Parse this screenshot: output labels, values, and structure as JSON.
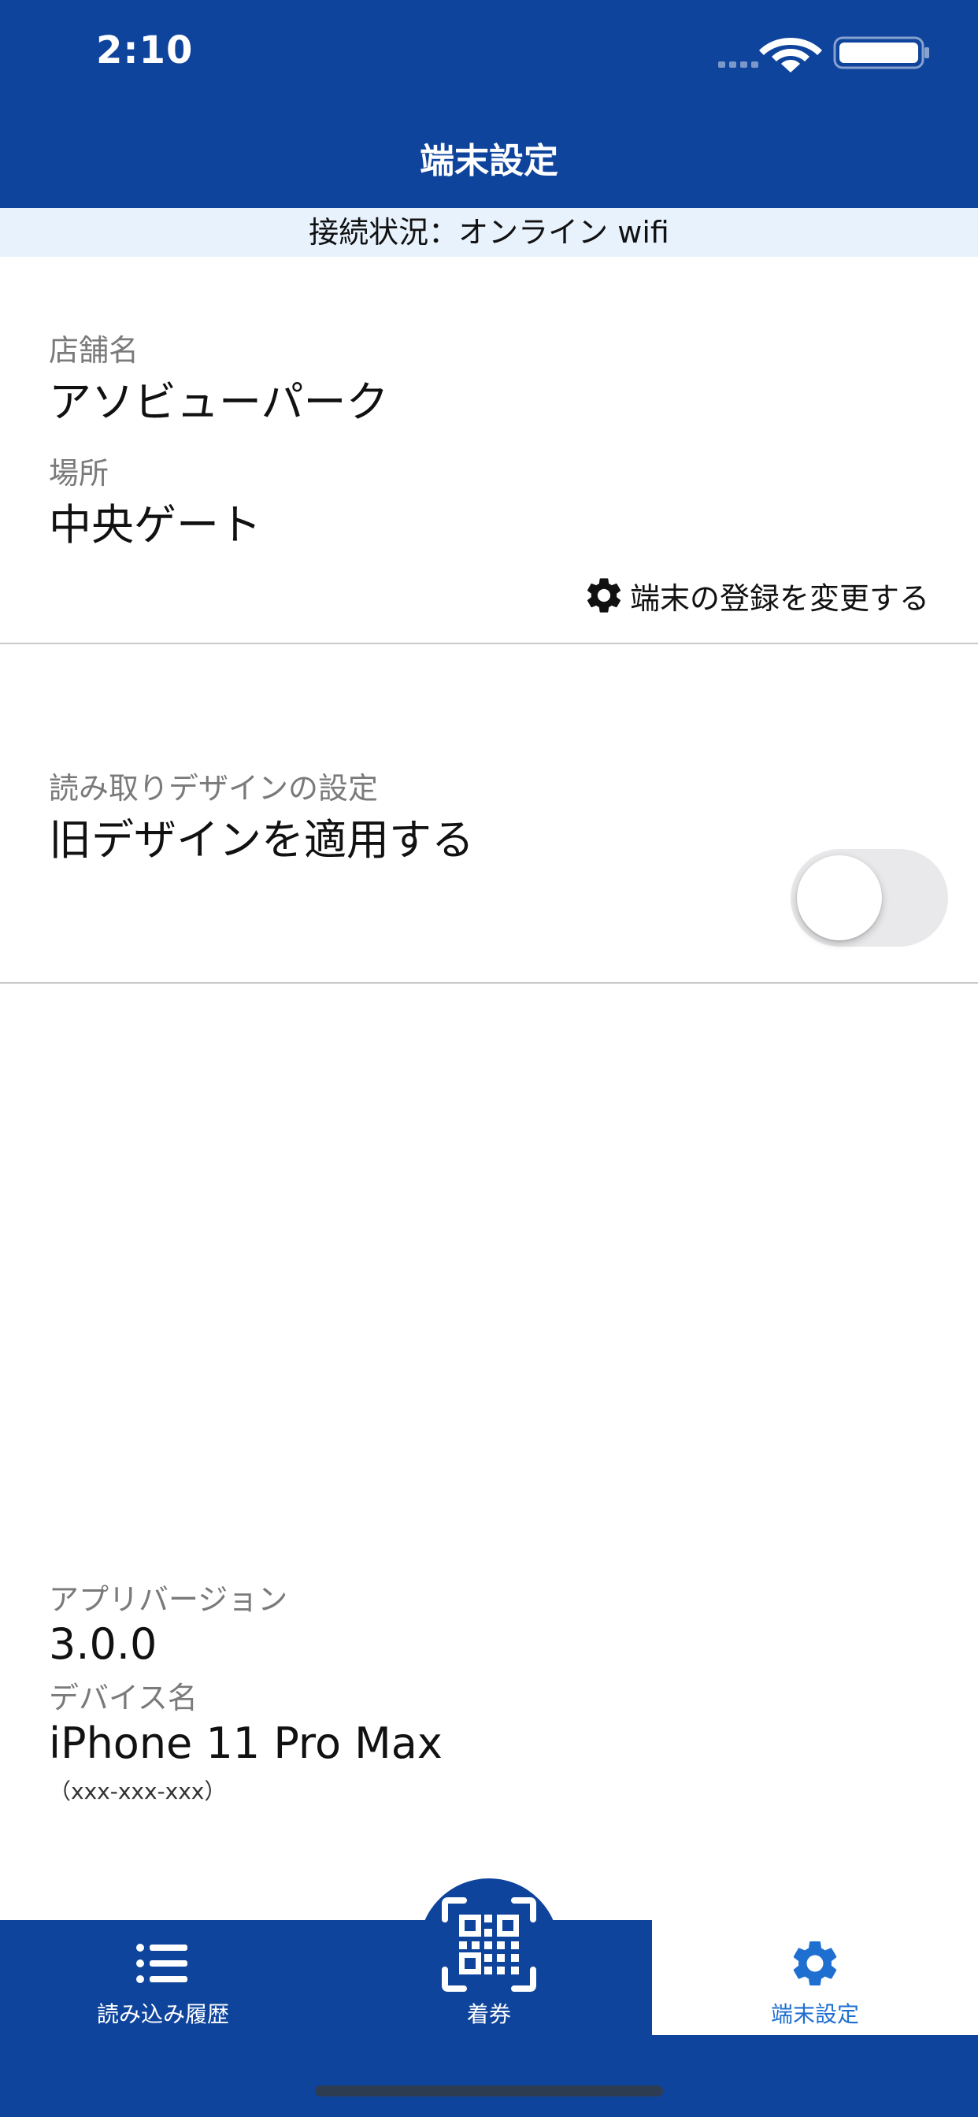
{
  "status_bar": {
    "time": "2:10"
  },
  "nav": {
    "title": "端末設定"
  },
  "connection": {
    "status_text": "接続状況：オンライン wifi"
  },
  "store": {
    "name_label": "店舗名",
    "name_value": "アソビューパーク",
    "place_label": "場所",
    "place_value": "中央ゲート",
    "change_registration_label": "端末の登録を変更する"
  },
  "design_setting": {
    "section_label": "読み取りデザインの設定",
    "option_label": "旧デザインを適用する",
    "enabled": false
  },
  "app_info": {
    "version_label": "アプリバージョン",
    "version_value": "3.0.0",
    "device_label": "デバイス名",
    "device_value": "iPhone 11 Pro Max",
    "device_id": "（xxx-xxx-xxx）"
  },
  "tabbar": {
    "history_label": "読み込み履歴",
    "checkin_label": "着券",
    "settings_label": "端末設定",
    "active_tab": "端末設定"
  },
  "colors": {
    "brand_blue": "#0f449d",
    "banner_bg": "#e8f2fd"
  }
}
